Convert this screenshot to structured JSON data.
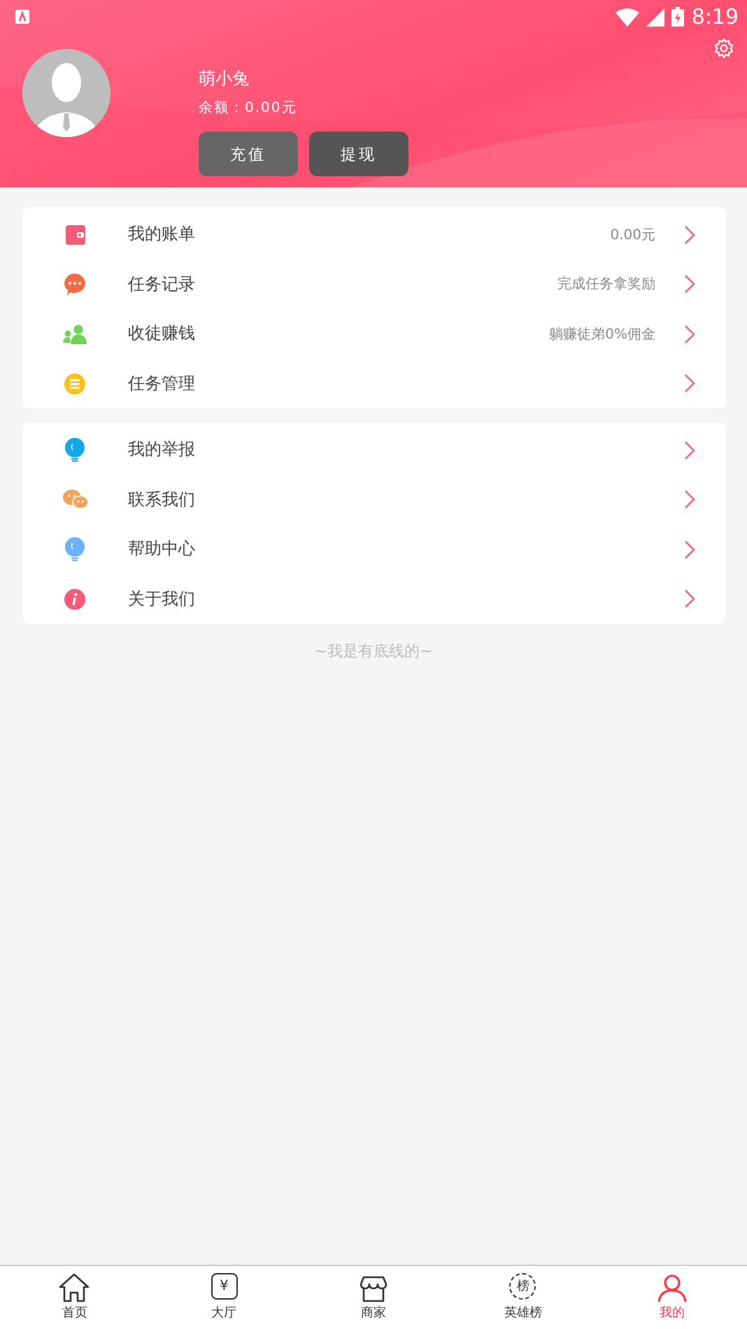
{
  "status_bar": {
    "time": "8:19"
  },
  "profile": {
    "name": "萌小兔",
    "balance": "余额：0.00元",
    "buttons": [
      {
        "label": "充值",
        "kind": "recharge"
      },
      {
        "label": "提现",
        "kind": "withdraw"
      }
    ]
  },
  "menu_sections": [
    {
      "items": [
        {
          "label": "我的账单",
          "detail": "0.00元"
        },
        {
          "label": "任务记录",
          "detail": "完成任务拿奖励"
        },
        {
          "label": "收徒赚钱",
          "detail": "躺赚徒弟0%佣金"
        },
        {
          "label": "任务管理"
        }
      ]
    },
    {
      "items": [
        {
          "label": "我的举报"
        },
        {
          "label": "联系我们"
        },
        {
          "label": "帮助中心"
        },
        {
          "label": "关于我们"
        }
      ]
    }
  ],
  "footer_note": "~我是有底线的~",
  "bottom_nav": [
    {
      "label": "首页",
      "kind": "home",
      "selected": false
    },
    {
      "label": "大厅",
      "kind": "hall",
      "glyph": "¥",
      "selected": false
    },
    {
      "label": "商家",
      "kind": "shop",
      "selected": false
    },
    {
      "label": "英雄榜",
      "kind": "rank",
      "glyph": "榜",
      "selected": false
    },
    {
      "label": "我的",
      "kind": "me",
      "selected": true
    }
  ]
}
